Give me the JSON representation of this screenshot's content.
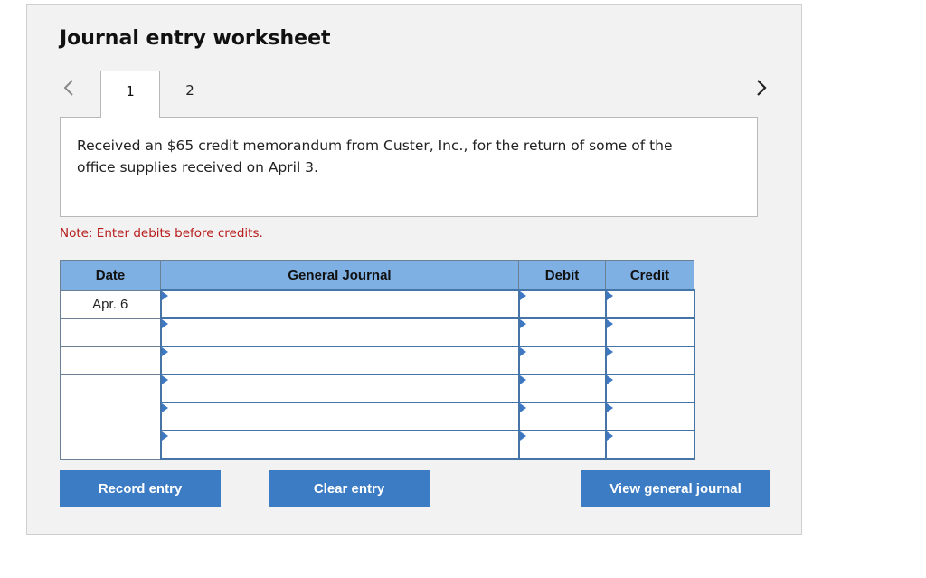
{
  "worksheet": {
    "title": "Journal entry worksheet",
    "tabs": [
      {
        "label": "1",
        "active": true
      },
      {
        "label": "2",
        "active": false
      }
    ],
    "description": "Received an $65 credit memorandum from Custer, Inc., for the return of some of the office supplies received on April 3.",
    "note": "Note: Enter debits before credits.",
    "nav_icons": {
      "prev": "chevron-left-icon",
      "next": "chevron-right-icon"
    }
  },
  "table": {
    "headers": {
      "date": "Date",
      "account": "General Journal",
      "debit": "Debit",
      "credit": "Credit"
    },
    "rows": [
      {
        "date": "Apr. 6",
        "account": "",
        "debit": "",
        "credit": ""
      },
      {
        "date": "",
        "account": "",
        "debit": "",
        "credit": ""
      },
      {
        "date": "",
        "account": "",
        "debit": "",
        "credit": ""
      },
      {
        "date": "",
        "account": "",
        "debit": "",
        "credit": ""
      },
      {
        "date": "",
        "account": "",
        "debit": "",
        "credit": ""
      },
      {
        "date": "",
        "account": "",
        "debit": "",
        "credit": ""
      }
    ]
  },
  "buttons": {
    "record": "Record entry",
    "clear": "Clear entry",
    "view": "View general journal"
  },
  "colors": {
    "header_bg": "#7eb0e3",
    "button_bg": "#3c7cc4",
    "note_text": "#b71c1c",
    "entry_border": "#4574a8"
  }
}
